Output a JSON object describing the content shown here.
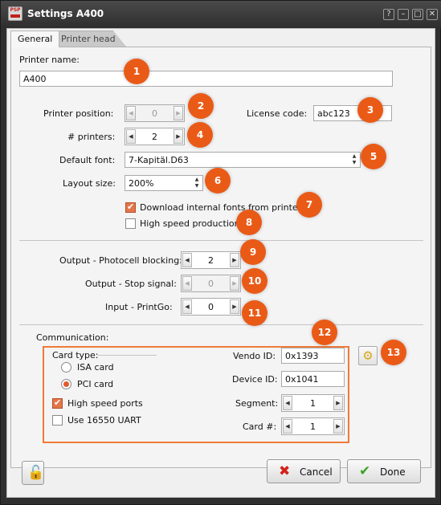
{
  "window": {
    "title": "Settings A400",
    "app_icon_text": "PSP"
  },
  "titlebar_buttons": {
    "help": "?",
    "minimize": "–",
    "maximize": "□",
    "close": "✕"
  },
  "tabs": [
    {
      "label": "General",
      "active": true
    },
    {
      "label": "Printer head",
      "active": false
    }
  ],
  "printer_name": {
    "label": "Printer name:",
    "value": "A400"
  },
  "printer_position": {
    "label": "Printer position:",
    "value": "0",
    "enabled": false
  },
  "license_code": {
    "label": "License code:",
    "value": "abc123"
  },
  "num_printers": {
    "label": "# printers:",
    "value": "2"
  },
  "default_font": {
    "label": "Default font:",
    "value": "7-Kapitäl.D63"
  },
  "layout_size": {
    "label": "Layout size:",
    "value": "200%"
  },
  "download_fonts": {
    "label": "Download internal fonts from printer",
    "checked": true
  },
  "high_speed_production": {
    "label": "High speed production",
    "checked": false
  },
  "output_photocell": {
    "label": "Output - Photocell blocking:",
    "value": "2",
    "enabled": true
  },
  "output_stop": {
    "label": "Output - Stop signal:",
    "value": "0",
    "enabled": false
  },
  "input_printgo": {
    "label": "Input - PrintGo:",
    "value": "0",
    "enabled": true
  },
  "communication": {
    "label": "Communication:",
    "card_type_label": "Card type:",
    "isa_card": {
      "label": "ISA card",
      "selected": false
    },
    "pci_card": {
      "label": "PCI card",
      "selected": true
    },
    "high_speed_ports": {
      "label": "High speed ports",
      "checked": true
    },
    "use_16550": {
      "label": "Use 16550 UART",
      "checked": false
    },
    "vendo_id": {
      "label": "Vendo ID:",
      "value": "0x1393"
    },
    "device_id": {
      "label": "Device ID:",
      "value": "0x1041"
    },
    "segment": {
      "label": "Segment:",
      "value": "1"
    },
    "card_num": {
      "label": "Card #:",
      "value": "1"
    }
  },
  "footer": {
    "cancel": "Cancel",
    "done": "Done"
  },
  "markers": [
    "1",
    "2",
    "3",
    "4",
    "5",
    "6",
    "7",
    "8",
    "9",
    "10",
    "11",
    "12",
    "13"
  ],
  "colors": {
    "marker": "#ea5a17",
    "highlight_border": "#ef7a3a",
    "titlebar": "#2f2f2f"
  },
  "icons": {
    "lock": "lock-icon",
    "cancel": "red-x-icon",
    "done": "green-check-icon",
    "settings": "gear-icon"
  }
}
